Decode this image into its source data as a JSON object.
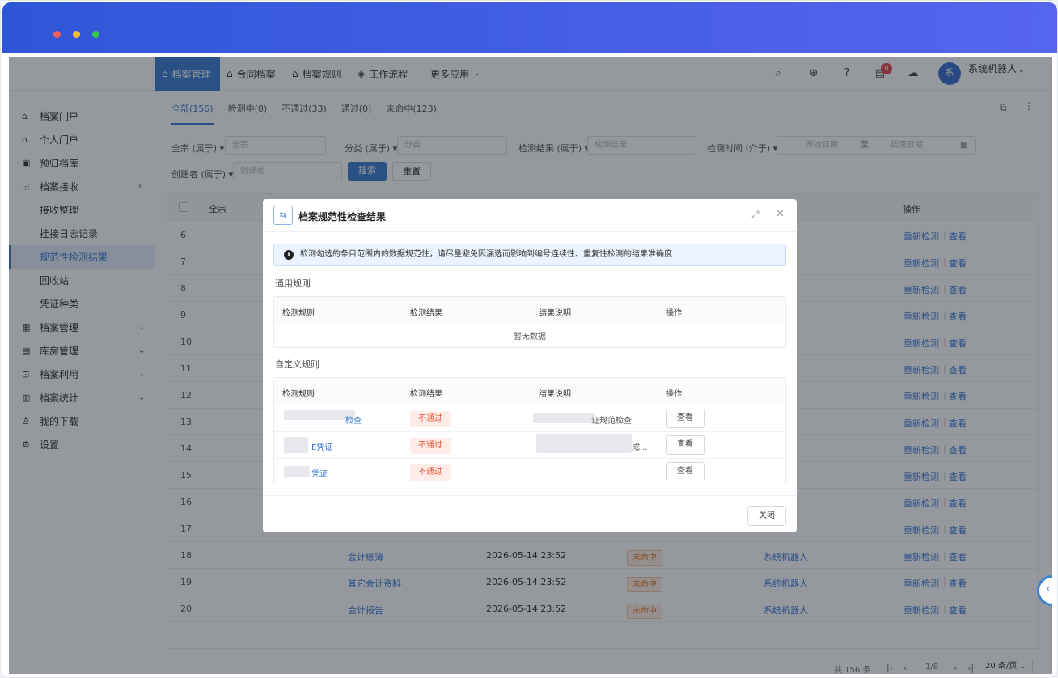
{
  "header": {
    "nav": [
      "档案管理",
      "合同档案",
      "档案规则",
      "工作流程",
      "更多应用"
    ],
    "notification_count": "8",
    "user_name": "系统机器人",
    "avatar_text": "系"
  },
  "sidebar": {
    "items": [
      "档案门户",
      "个人门户",
      "预归档库",
      "档案接收",
      "接收整理",
      "挂接日志记录",
      "规范性检测结果",
      "回收站",
      "凭证种类",
      "档案管理",
      "库房管理",
      "档案利用",
      "档案统计",
      "我的下载",
      "设置"
    ]
  },
  "tabs": [
    "全部(156)",
    "检测中(0)",
    "不通过(33)",
    "通过(0)",
    "未命中(123)"
  ],
  "filters": {
    "f1_label": "全宗 (属于)",
    "f1_placeholder": "全宗",
    "f2_label": "分类 (属于)",
    "f2_placeholder": "分类",
    "f3_label": "检测结果 (属于)",
    "f3_placeholder": "检测结果",
    "f4_label": "检测时间 (介于)",
    "start_date": "开始日期",
    "to": "至",
    "end_date": "结束日期",
    "f5_label": "创建者 (属于)",
    "f5_placeholder": "创建者",
    "search": "搜索",
    "reset": "重置"
  },
  "table": {
    "col_fonds": "全宗",
    "col_ops": "操作",
    "recheck": "重新检测",
    "view": "查看",
    "row_numbers": [
      "6",
      "7",
      "8",
      "9",
      "10",
      "11",
      "12",
      "13",
      "14",
      "15",
      "16",
      "17",
      "18",
      "19",
      "20"
    ],
    "rows_visible": [
      {
        "no": "18",
        "category": "会计账簿",
        "time": "2026-05-14 23:52",
        "status": "未命中",
        "creator": "系统机器人"
      },
      {
        "no": "19",
        "category": "其它会计资料",
        "time": "2026-05-14 23:52",
        "status": "未命中",
        "creator": "系统机器人"
      },
      {
        "no": "20",
        "category": "会计报告",
        "time": "2026-05-14 23:52",
        "status": "未命中",
        "creator": "系统机器人"
      }
    ]
  },
  "pagination": {
    "total": "共 156 条",
    "page": "1/8",
    "page_size": "20 条/页"
  },
  "modal": {
    "title": "档案规范性检查结果",
    "alert": "检测勾选的条目范围内的数据规范性，请尽量避免因漏选而影响到编号连续性、重复性检测的结果准确度",
    "general_section": "通用规则",
    "custom_section": "自定义规则",
    "cols": [
      "检测规则",
      "检测结果",
      "结果说明",
      "操作"
    ],
    "empty": "暂无数据",
    "custom_rows": [
      {
        "rule": "检查",
        "result": "不通过",
        "note": "证规范检查",
        "action": "查看"
      },
      {
        "rule": "E凭证",
        "result": "不通过",
        "note": "成...",
        "action": "查看"
      },
      {
        "rule": "凭证",
        "result": "不通过",
        "note": "",
        "action": "查看"
      }
    ],
    "close": "关闭"
  }
}
